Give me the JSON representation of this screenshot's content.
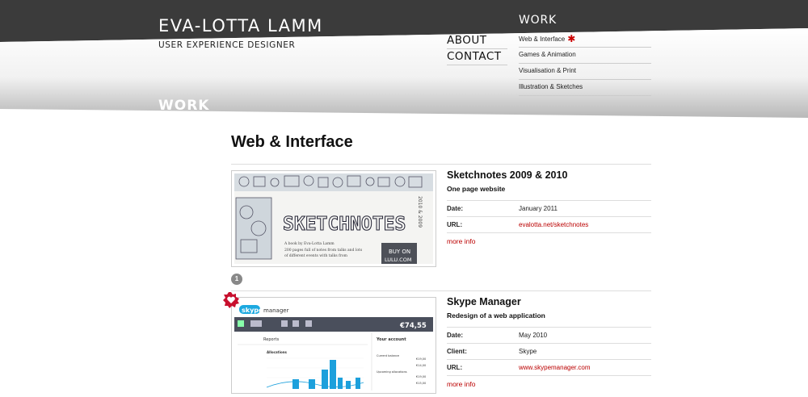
{
  "site": {
    "title": "EVA-LOTTA LAMM",
    "subtitle": "USER EXPERIENCE DESIGNER",
    "section_banner": "WORK"
  },
  "main_nav": [
    {
      "label": "ABOUT"
    },
    {
      "label": "CONTACT"
    }
  ],
  "work_nav": {
    "heading": "WORK",
    "items": [
      {
        "label": "Web & Interface",
        "active": true
      },
      {
        "label": "Games & Animation"
      },
      {
        "label": "Visualisation & Print"
      },
      {
        "label": "Illustration & Sketches"
      }
    ],
    "active_marker": "✱"
  },
  "page": {
    "title": "Web & Interface"
  },
  "projects": [
    {
      "title": "Sketchnotes 2009 & 2010",
      "description": "One page website",
      "badge": "1",
      "meta": [
        {
          "label": "Date:",
          "value": "January 2011",
          "link": false
        },
        {
          "label": "URL:",
          "value": "evalotta.net/sketchnotes",
          "link": true
        }
      ],
      "more": "more info",
      "thumb": {
        "word": "SKETCHNOTES",
        "side_text": "2010 & 2009",
        "blurb_1": "A book by Eva-Lotta Lamm",
        "blurb_2": "200 pages full of notes from talks and lots",
        "blurb_3": "of different events with talks from",
        "cta_1": "BUY ON",
        "cta_2": "LULU.COM"
      }
    },
    {
      "title": "Skype Manager",
      "description": "Redesign of a web application",
      "meta": [
        {
          "label": "Date:",
          "value": "May 2010",
          "link": false
        },
        {
          "label": "Client:",
          "value": "Skype",
          "link": false
        },
        {
          "label": "URL:",
          "value": "www.skypemanager.com",
          "link": true
        }
      ],
      "more": "more info",
      "thumb": {
        "brand": "skype",
        "brand_suffix": "manager",
        "amount": "€74,55",
        "tab": "Reports",
        "chart_title": "Allocations",
        "side_heading": "Your account",
        "side_1": "Current balance",
        "side_2": "Upcoming allocations",
        "val_1": "€19,00",
        "val_2": "€14,00",
        "val_3": "€19,00",
        "val_4": "€15,00"
      }
    }
  ]
}
